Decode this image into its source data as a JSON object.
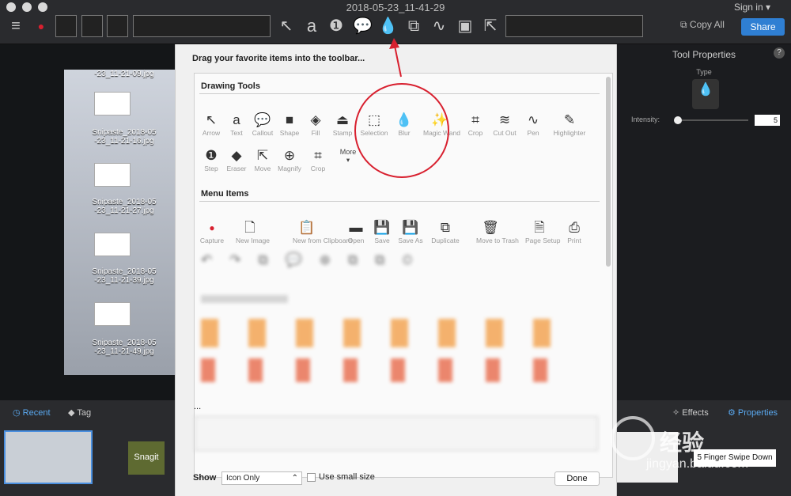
{
  "window": {
    "title": "2018-05-23_11-41-29",
    "signin": "Sign in ▾"
  },
  "toolbar": {
    "copy_all": "Copy All",
    "share": "Share"
  },
  "desktop": {
    "items": [
      "-23_11-21-09.jpg",
      "Snipaste_2018-05\n-23_11-21-16.jpg",
      "Snipaste_2018-05\n-23_11-21-27.jpg",
      "Snipaste_2018-05\n-23_11-21-39.jpg",
      "Snipaste_2018-05\n-23_11-21-49.jpg"
    ]
  },
  "dialog": {
    "heading": "Drag your favorite items into the toolbar...",
    "drawing_tools_title": "Drawing Tools",
    "drawing_tools": [
      "Arrow",
      "Text",
      "Callout",
      "Shape",
      "Fill",
      "Stamp",
      "Selection",
      "Blur",
      "Magic Wand",
      "Crop",
      "Cut Out",
      "Pen",
      "Highlighter",
      "Step",
      "Eraser",
      "Move",
      "Magnify",
      "Crop",
      "More"
    ],
    "menu_items_title": "Menu Items",
    "menu_items": [
      "Capture",
      "New Image",
      "New from Clipboard",
      "Open",
      "Save",
      "Save As",
      "Duplicate",
      "Move to Trash",
      "Page Setup",
      "Print"
    ],
    "lower_heading": "...",
    "show_label": "Show",
    "show_value": "Icon Only",
    "small_size_label": "Use small size",
    "done": "Done"
  },
  "panel": {
    "title": "Tool Properties",
    "help": "?",
    "type_label": "Type",
    "intensity_label": "Intensity:",
    "intensity_value": "5"
  },
  "bottom": {
    "recent": "Recent",
    "tag": "Tag",
    "effects": "Effects",
    "properties": "Properties",
    "snagit": "Snagit",
    "five_finger": "5 Finger Swipe Down"
  },
  "watermark": {
    "text1": "经验",
    "text2": "jingyan.baidu.com"
  },
  "colors": {
    "accent": "#2f7fd3",
    "annotation_red": "#d8202f"
  }
}
